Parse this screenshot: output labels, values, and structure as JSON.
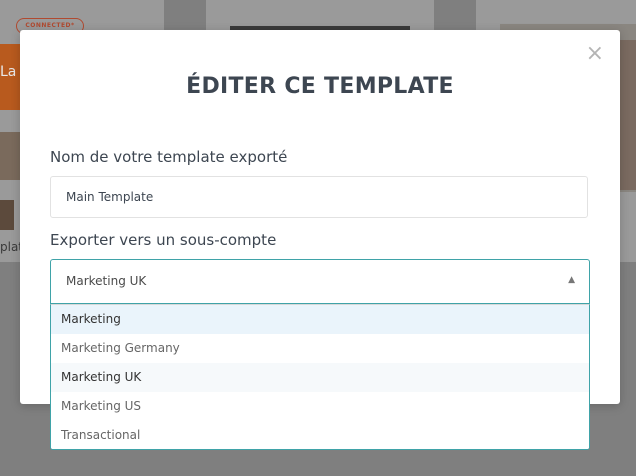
{
  "background": {
    "brand_badge": "CONNECTED*",
    "orange_text": "La",
    "card_label": "plat"
  },
  "modal": {
    "title": "ÉDITER CE TEMPLATE",
    "close_glyph": "×",
    "name_field": {
      "label": "Nom de votre template exporté",
      "value": "Main Template"
    },
    "export_field": {
      "label": "Exporter vers un sous-compte",
      "selected": "Marketing UK",
      "arrow_glyph": "▲",
      "options": [
        {
          "label": "Marketing"
        },
        {
          "label": "Marketing Germany"
        },
        {
          "label": "Marketing UK"
        },
        {
          "label": "Marketing US"
        },
        {
          "label": "Transactional"
        }
      ]
    }
  }
}
